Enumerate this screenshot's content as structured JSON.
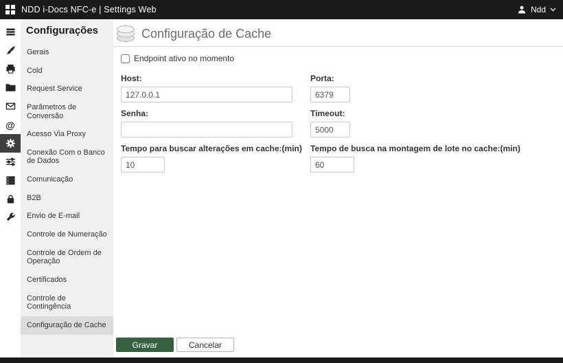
{
  "topbar": {
    "title": "NDD i-Docs NFC-e | Settings Web",
    "user": "Ndd",
    "icons": [
      "apps-grid-icon",
      "person-icon",
      "chevron-down-icon"
    ]
  },
  "rail": {
    "icons": [
      "menu-icon",
      "brush-icon",
      "printer-icon",
      "folder-icon",
      "envelope-icon",
      "at-sign-icon",
      "gear-icon",
      "sliders-icon",
      "list-icon",
      "lock-icon",
      "wrench-icon"
    ],
    "selected": "gear-icon"
  },
  "sidebar": {
    "title": "Configurações",
    "items": [
      "Gerais",
      "Cold",
      "Request Service",
      "Parâmetros de Conversão",
      "Acesso Via Proxy",
      "Conexão Com o Banco de Dados",
      "Comunicação",
      "B2B",
      "Envio de E-mail",
      "Controle de Numeração",
      "Controle de Ordem de Operação",
      "Certificados",
      "Controle de Contingência",
      "Configuração de Cache"
    ],
    "selected_index": 13
  },
  "main": {
    "header": {
      "title": "Configuração de Cache",
      "icon": "cache-stack-icon"
    },
    "endpoint_checkbox": {
      "label": "Endpoint ativo no momento",
      "checked": false
    },
    "fields": {
      "host": {
        "label": "Host:",
        "value": "127.0.0.1"
      },
      "porta": {
        "label": "Porta:",
        "value": "6379"
      },
      "senha": {
        "label": "Senha:",
        "value": ""
      },
      "timeout": {
        "label": "Timeout:",
        "value": "5000"
      },
      "tempo_alteracoes": {
        "label": "Tempo para buscar alterações em cache:(min)",
        "value": "10"
      },
      "tempo_lote": {
        "label": "Tempo de busca na montagem de lote no cache:(min)",
        "value": "60"
      }
    },
    "actions": {
      "save": "Gravar",
      "cancel": "Cancelar"
    }
  },
  "colors": {
    "accent_green": "#35613f",
    "topbar_bg": "#1b1b1b",
    "sidebar_bg": "#f0f0f0",
    "selected_item_bg": "#dcdcdc"
  }
}
